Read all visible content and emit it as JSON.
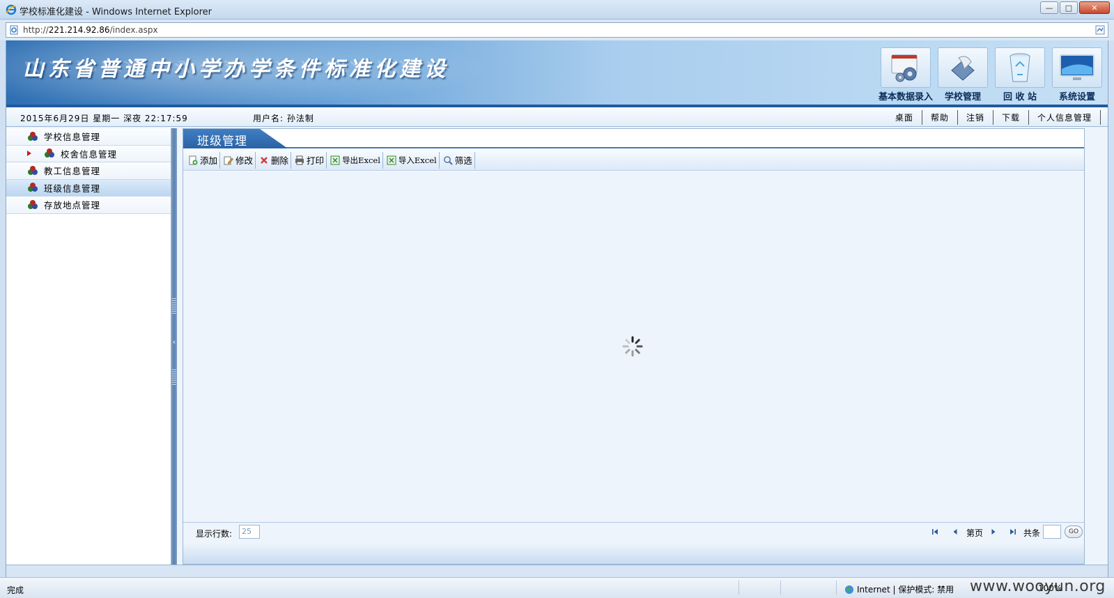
{
  "window": {
    "title": "学校标准化建设 - Windows Internet Explorer",
    "url_prefix": "http://",
    "url_host": "221.214.92.86",
    "url_path": "/index.aspx",
    "buttons": {
      "minimize": "—",
      "maximize": "□",
      "close": "✕"
    }
  },
  "banner": {
    "site_title": "山东省普通中小学办学条件标准化建设",
    "nav": [
      {
        "label": "基本数据录入",
        "icon": "data-entry-icon"
      },
      {
        "label": "学校管理",
        "icon": "school-manage-icon"
      },
      {
        "label": "回 收 站",
        "icon": "recycle-bin-icon"
      },
      {
        "label": "系统设置",
        "icon": "monitor-settings-icon"
      }
    ]
  },
  "infobar": {
    "date": "2015年6月29日   星期一   深夜  22:17:59",
    "user": "用户名: 孙法制",
    "links": [
      "桌面",
      "帮助",
      "注销",
      "下载",
      "个人信息管理"
    ]
  },
  "sidebar": {
    "items": [
      {
        "label": "学校信息管理",
        "sub": false,
        "active": false
      },
      {
        "label": "校舍信息管理",
        "sub": true,
        "active": false
      },
      {
        "label": "教工信息管理",
        "sub": false,
        "active": false
      },
      {
        "label": "班级信息管理",
        "sub": false,
        "active": true
      },
      {
        "label": "存放地点管理",
        "sub": false,
        "active": false
      }
    ]
  },
  "main": {
    "tab_title": "班级管理",
    "toolbar": [
      {
        "label": "添加",
        "icon": "add-icon"
      },
      {
        "label": "修改",
        "icon": "edit-icon"
      },
      {
        "label": "删除",
        "icon": "delete-icon"
      },
      {
        "label": "打印",
        "icon": "print-icon"
      },
      {
        "label": "导出Excel",
        "icon": "export-excel-icon"
      },
      {
        "label": "导入Excel",
        "icon": "import-excel-icon"
      },
      {
        "label": "筛选",
        "icon": "filter-icon"
      }
    ],
    "pager": {
      "rows_label": "显示行数:",
      "rows_value": "25",
      "page_label": "第页",
      "total_label": "共条",
      "go_label": "GO"
    }
  },
  "statusbar": {
    "status": "完成",
    "zone": "Internet | 保护模式: 禁用",
    "zoom": "100%",
    "watermark": "www.wooyun.org"
  },
  "colors": {
    "accent": "#2a63a5",
    "banner_dark": "#2e6fb3",
    "banner_light": "#c7e0f5",
    "active_row": "#bcd6f1"
  }
}
